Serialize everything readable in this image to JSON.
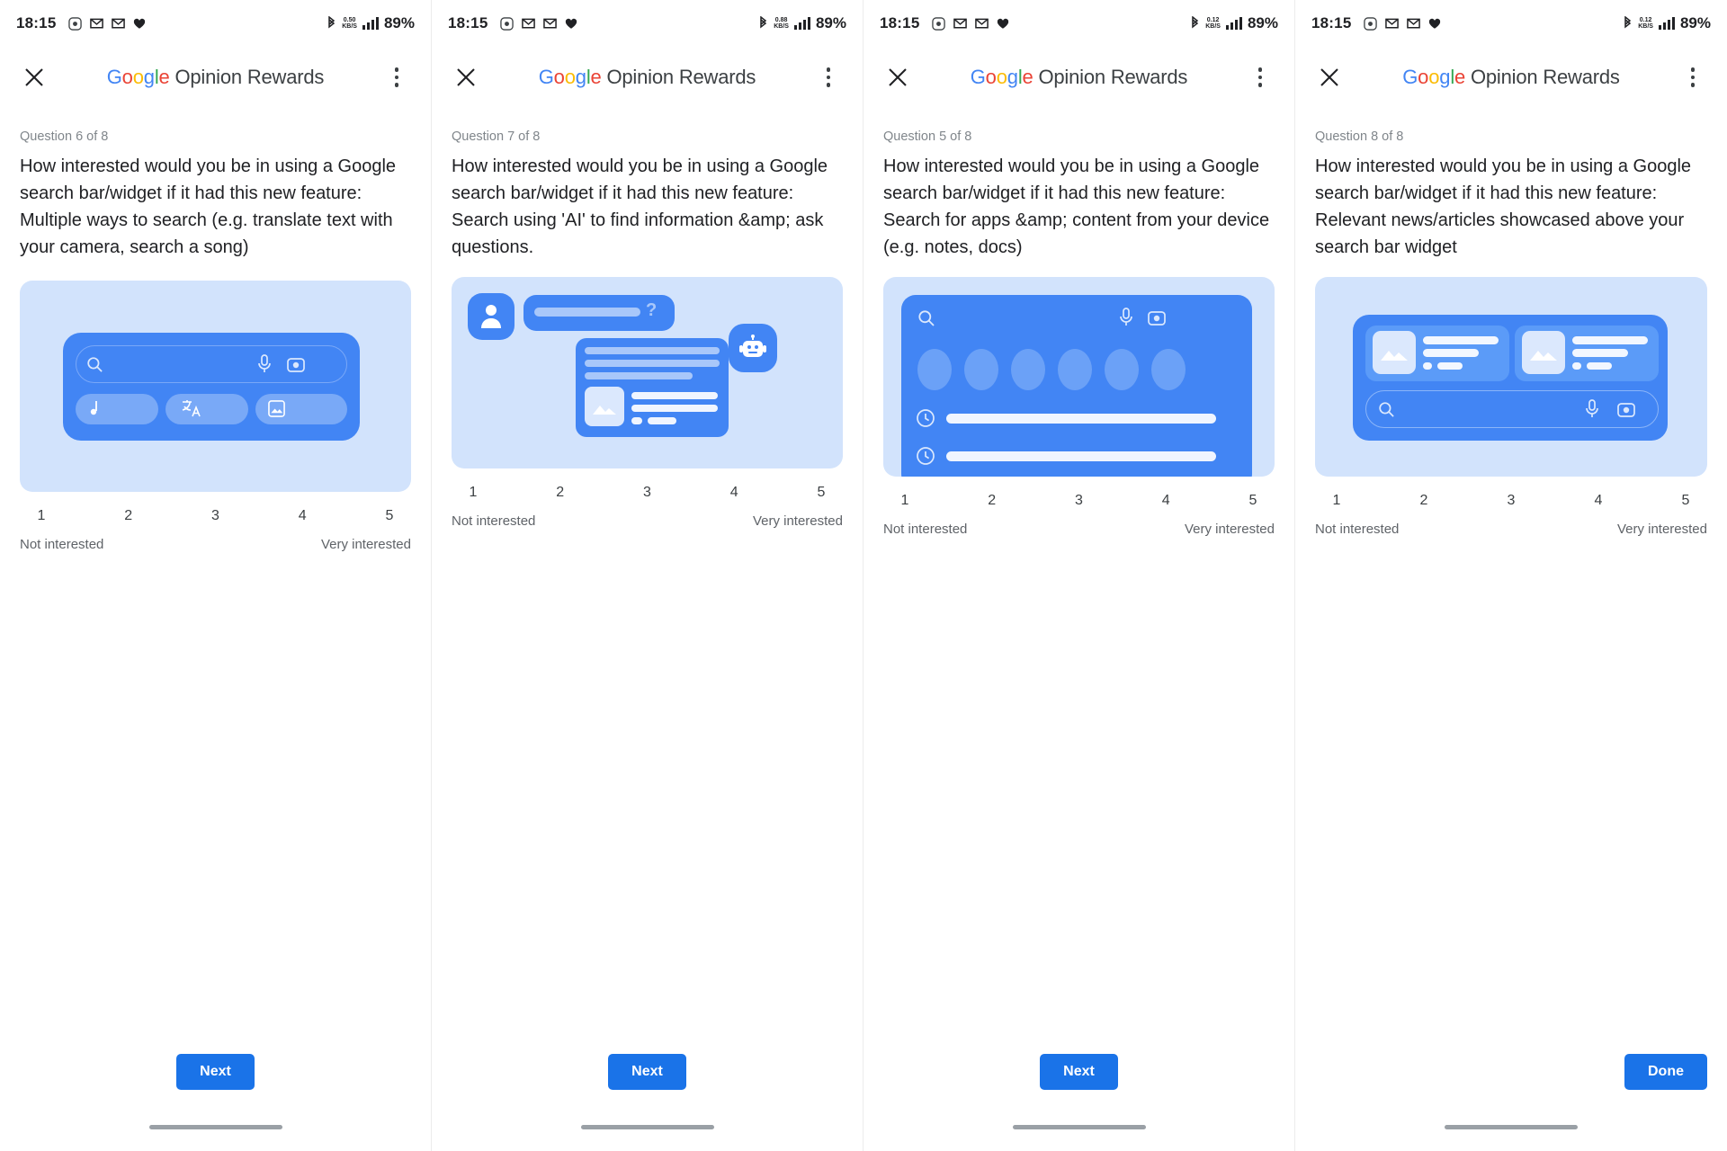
{
  "status_bar": {
    "time": "18:15",
    "battery": "89%",
    "data_rate_value": "0.50",
    "data_rate_unit": "KB/S",
    "left_icons": [
      "screen-record-icon",
      "mail-icon",
      "mail-icon",
      "heart-icon"
    ],
    "right_icons": [
      "bluetooth-icon",
      "data-rate-icon",
      "signal-bars-icon"
    ]
  },
  "app_bar": {
    "close_label": "✕",
    "brand": {
      "g1": "G",
      "o1": "o",
      "o2": "o",
      "g2": "g",
      "l": "l",
      "e": "e"
    },
    "title_rest": " Opinion Rewards",
    "overflow_label": "more-options"
  },
  "scale": {
    "numbers": [
      "1",
      "2",
      "3",
      "4",
      "5"
    ],
    "low_label": "Not interested",
    "high_label": "Very interested"
  },
  "colors": {
    "brand_blue": "#1a73e8",
    "illustration_bg": "#d2e3fc",
    "illustration_accent": "#4285F4",
    "text_primary": "#202124",
    "text_secondary": "#5f6368",
    "text_muted": "#80868b"
  },
  "screens": [
    {
      "question_counter": "Question 6 of 8",
      "question_text": "How interested would you be in using a Google search bar/widget if it had this new feature: Multiple ways to search (e.g. translate text with your camera, search a song)",
      "illustration": "multi-modal-search-bar",
      "button_label": "Next",
      "data_rate_value": "0.50"
    },
    {
      "question_counter": "Question 7 of 8",
      "question_text": "How interested would you be in using a Google search bar/widget if it had this new feature: Search using 'AI' to find information &amp; ask questions.",
      "illustration": "ai-chat-conversation",
      "button_label": "Next",
      "data_rate_value": "0.88"
    },
    {
      "question_counter": "Question 5 of 8",
      "question_text": "How interested would you be in using a Google search bar/widget if it had this new feature: Search for apps &amp; content from your device (e.g. notes, docs)",
      "illustration": "device-app-content-search",
      "button_label": "Next",
      "data_rate_value": "0.12"
    },
    {
      "question_counter": "Question 8 of 8",
      "question_text": "How interested would you be in using a Google search bar/widget if it had this new feature: Relevant news/articles showcased above your search bar widget",
      "illustration": "news-articles-above-widget",
      "button_label": "Done",
      "data_rate_value": "0.12"
    }
  ]
}
